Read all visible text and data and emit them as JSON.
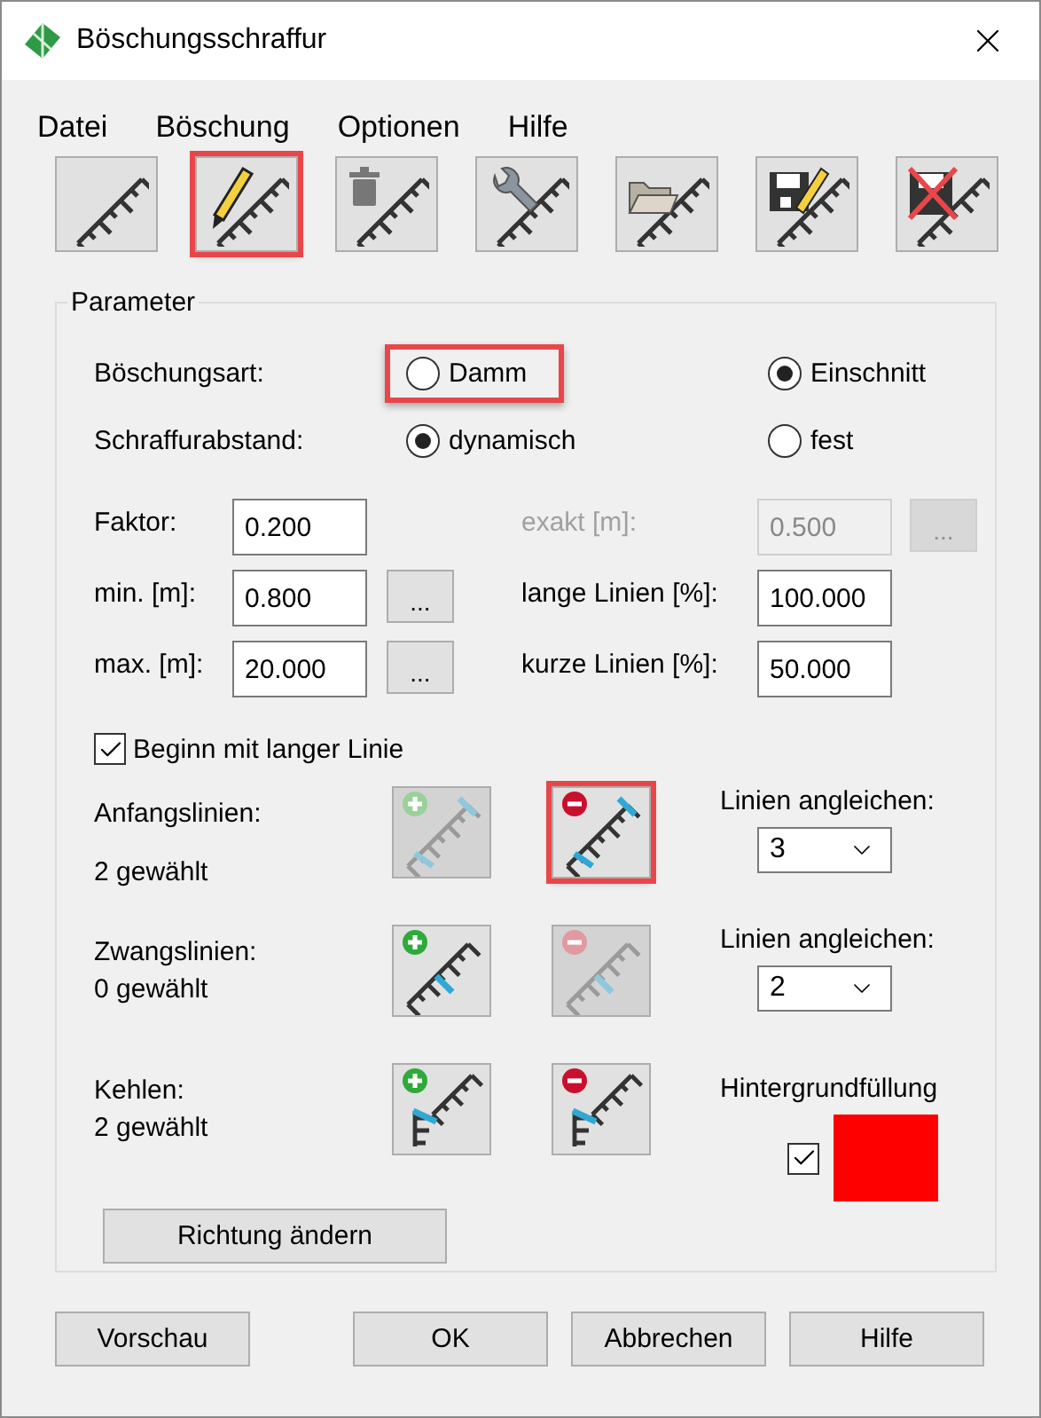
{
  "window": {
    "title": "Böschungsschraffur"
  },
  "menu": [
    {
      "label": "Datei"
    },
    {
      "label": "Böschung"
    },
    {
      "label": "Optionen"
    },
    {
      "label": "Hilfe"
    }
  ],
  "toolbar": [
    {
      "kind": "plain",
      "highlighted": false
    },
    {
      "kind": "pencil",
      "highlighted": true
    },
    {
      "kind": "trash",
      "highlighted": false
    },
    {
      "kind": "wrench",
      "highlighted": false
    },
    {
      "kind": "folder",
      "highlighted": false
    },
    {
      "kind": "save",
      "highlighted": false
    },
    {
      "kind": "delete",
      "highlighted": false
    }
  ],
  "parameter": {
    "legend": "Parameter",
    "radio_rows": [
      {
        "label": "Böschungsart:",
        "options": [
          {
            "label": "Damm",
            "selected": false,
            "highlighted": true
          },
          {
            "label": "Einschnitt",
            "selected": true,
            "highlighted": false
          }
        ]
      },
      {
        "label": "Schraffurabstand:",
        "options": [
          {
            "label": "dynamisch",
            "selected": true,
            "highlighted": false
          },
          {
            "label": "fest",
            "selected": false,
            "highlighted": false
          }
        ]
      }
    ],
    "field_rows": [
      {
        "left": {
          "label": "Faktor:",
          "value": "0.200"
        },
        "right": {
          "label": "exakt [m]:",
          "value": "0.500",
          "button": "...",
          "disabled": true
        }
      },
      {
        "left": {
          "label": "min. [m]:",
          "value": "0.800",
          "button": "..."
        },
        "right": {
          "label": "lange Linien [%]:",
          "value": "100.000",
          "disabled": false
        }
      },
      {
        "left": {
          "label": "max. [m]:",
          "value": "20.000",
          "button": "..."
        },
        "right": {
          "label": "kurze Linien [%]:",
          "value": "50.000",
          "disabled": false
        }
      }
    ],
    "long_line": {
      "label": "Beginn mit langer Linie",
      "checked": true
    },
    "line_groups": [
      {
        "kind": "start",
        "label": "Anfangslinien:",
        "count": "2 gewählt",
        "add": {
          "disabled": true,
          "highlighted": false
        },
        "remove": {
          "disabled": false,
          "highlighted": true
        },
        "right": {
          "kind": "select",
          "label": "Linien angleichen:",
          "value": "3"
        }
      },
      {
        "kind": "forced",
        "label": "Zwangslinien:",
        "count": "0 gewählt",
        "add": {
          "disabled": false,
          "highlighted": false
        },
        "remove": {
          "disabled": true,
          "highlighted": false
        },
        "right": {
          "kind": "select",
          "label": "Linien angleichen:",
          "value": "2"
        }
      },
      {
        "kind": "throat",
        "label": "Kehlen:",
        "count": "2 gewählt",
        "add": {
          "disabled": false,
          "highlighted": false
        },
        "remove": {
          "disabled": false,
          "highlighted": false
        },
        "right": {
          "kind": "fill",
          "label": "Hintergrundfüllung",
          "checked": true,
          "color": "#ff0000"
        }
      }
    ],
    "direction_button": "Richtung ändern"
  },
  "buttons": [
    {
      "label": "Vorschau"
    },
    {
      "label": "OK"
    },
    {
      "label": "Abbrechen"
    },
    {
      "label": "Hilfe"
    }
  ]
}
